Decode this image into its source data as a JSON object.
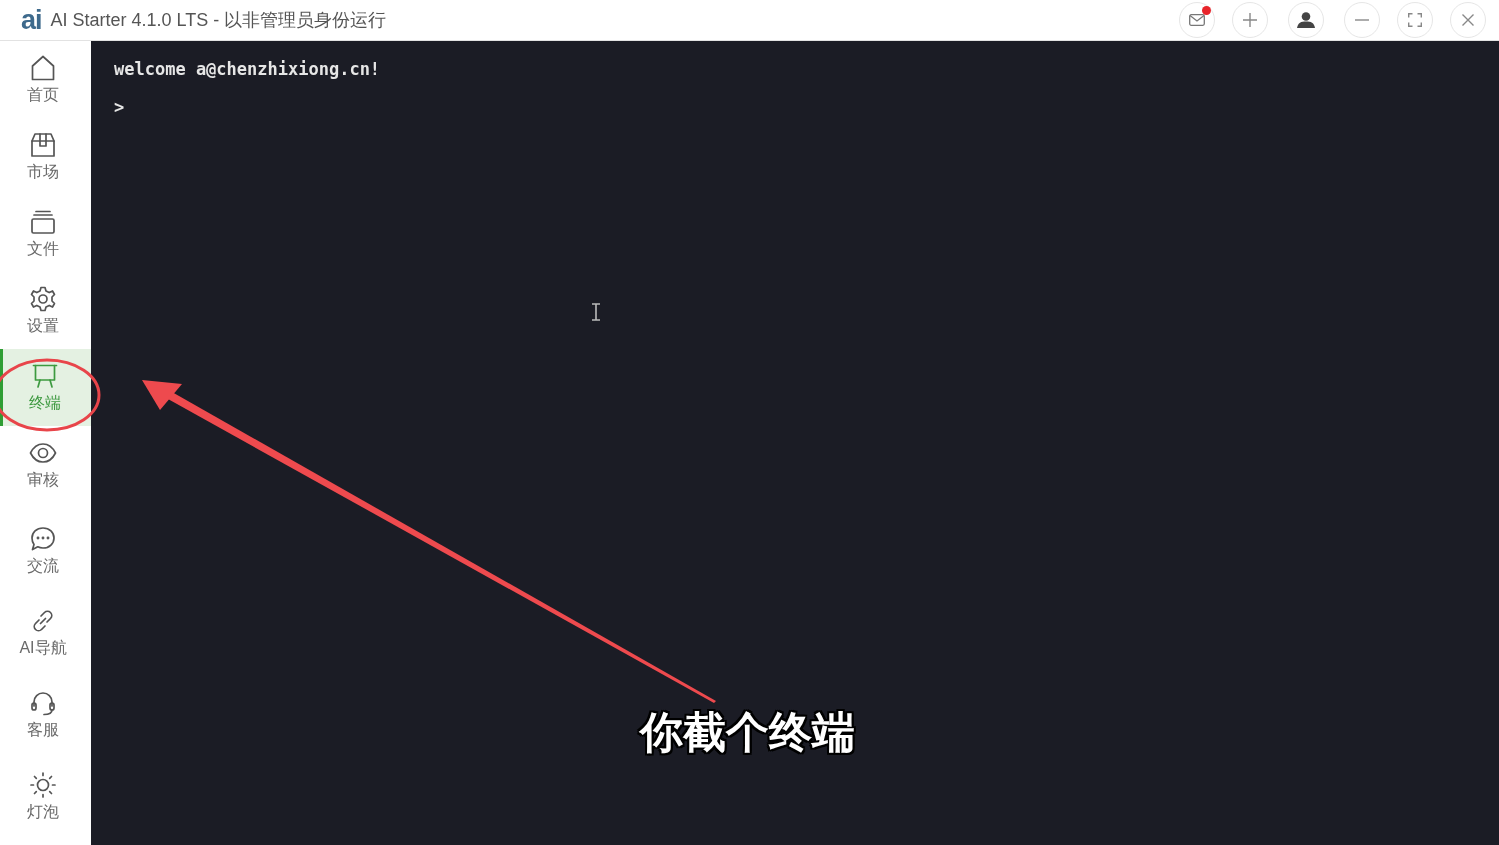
{
  "window": {
    "logo": "ai",
    "title": "AI Starter 4.1.0 LTS - 以非管理员身份运行"
  },
  "title_bar": {
    "buttons": [
      {
        "kind": "mail",
        "unread": true
      },
      {
        "kind": "add",
        "unread": false
      },
      {
        "kind": "account",
        "unread": false
      },
      {
        "kind": "minimize",
        "unread": false
      },
      {
        "kind": "maximize",
        "unread": false
      },
      {
        "kind": "close",
        "unread": false
      }
    ]
  },
  "sidebar": {
    "items": [
      {
        "label": "首页",
        "selected": false
      },
      {
        "label": "市场",
        "selected": false
      },
      {
        "label": "文件",
        "selected": false
      },
      {
        "label": "设置",
        "selected": false
      },
      {
        "label": "终端",
        "selected": true
      },
      {
        "label": "审核",
        "selected": false
      },
      {
        "label": "交流",
        "selected": false
      },
      {
        "label": "AI导航",
        "selected": false
      },
      {
        "label": "客服",
        "selected": false
      },
      {
        "label": "灯泡",
        "selected": false
      }
    ]
  },
  "terminal": {
    "lines": [
      {
        "kind": "output",
        "text": "welcome a@chenzhixiong.cn!"
      },
      {
        "kind": "prompt",
        "text": ">"
      }
    ]
  },
  "annotation": {
    "caption": "你截个终端"
  }
}
